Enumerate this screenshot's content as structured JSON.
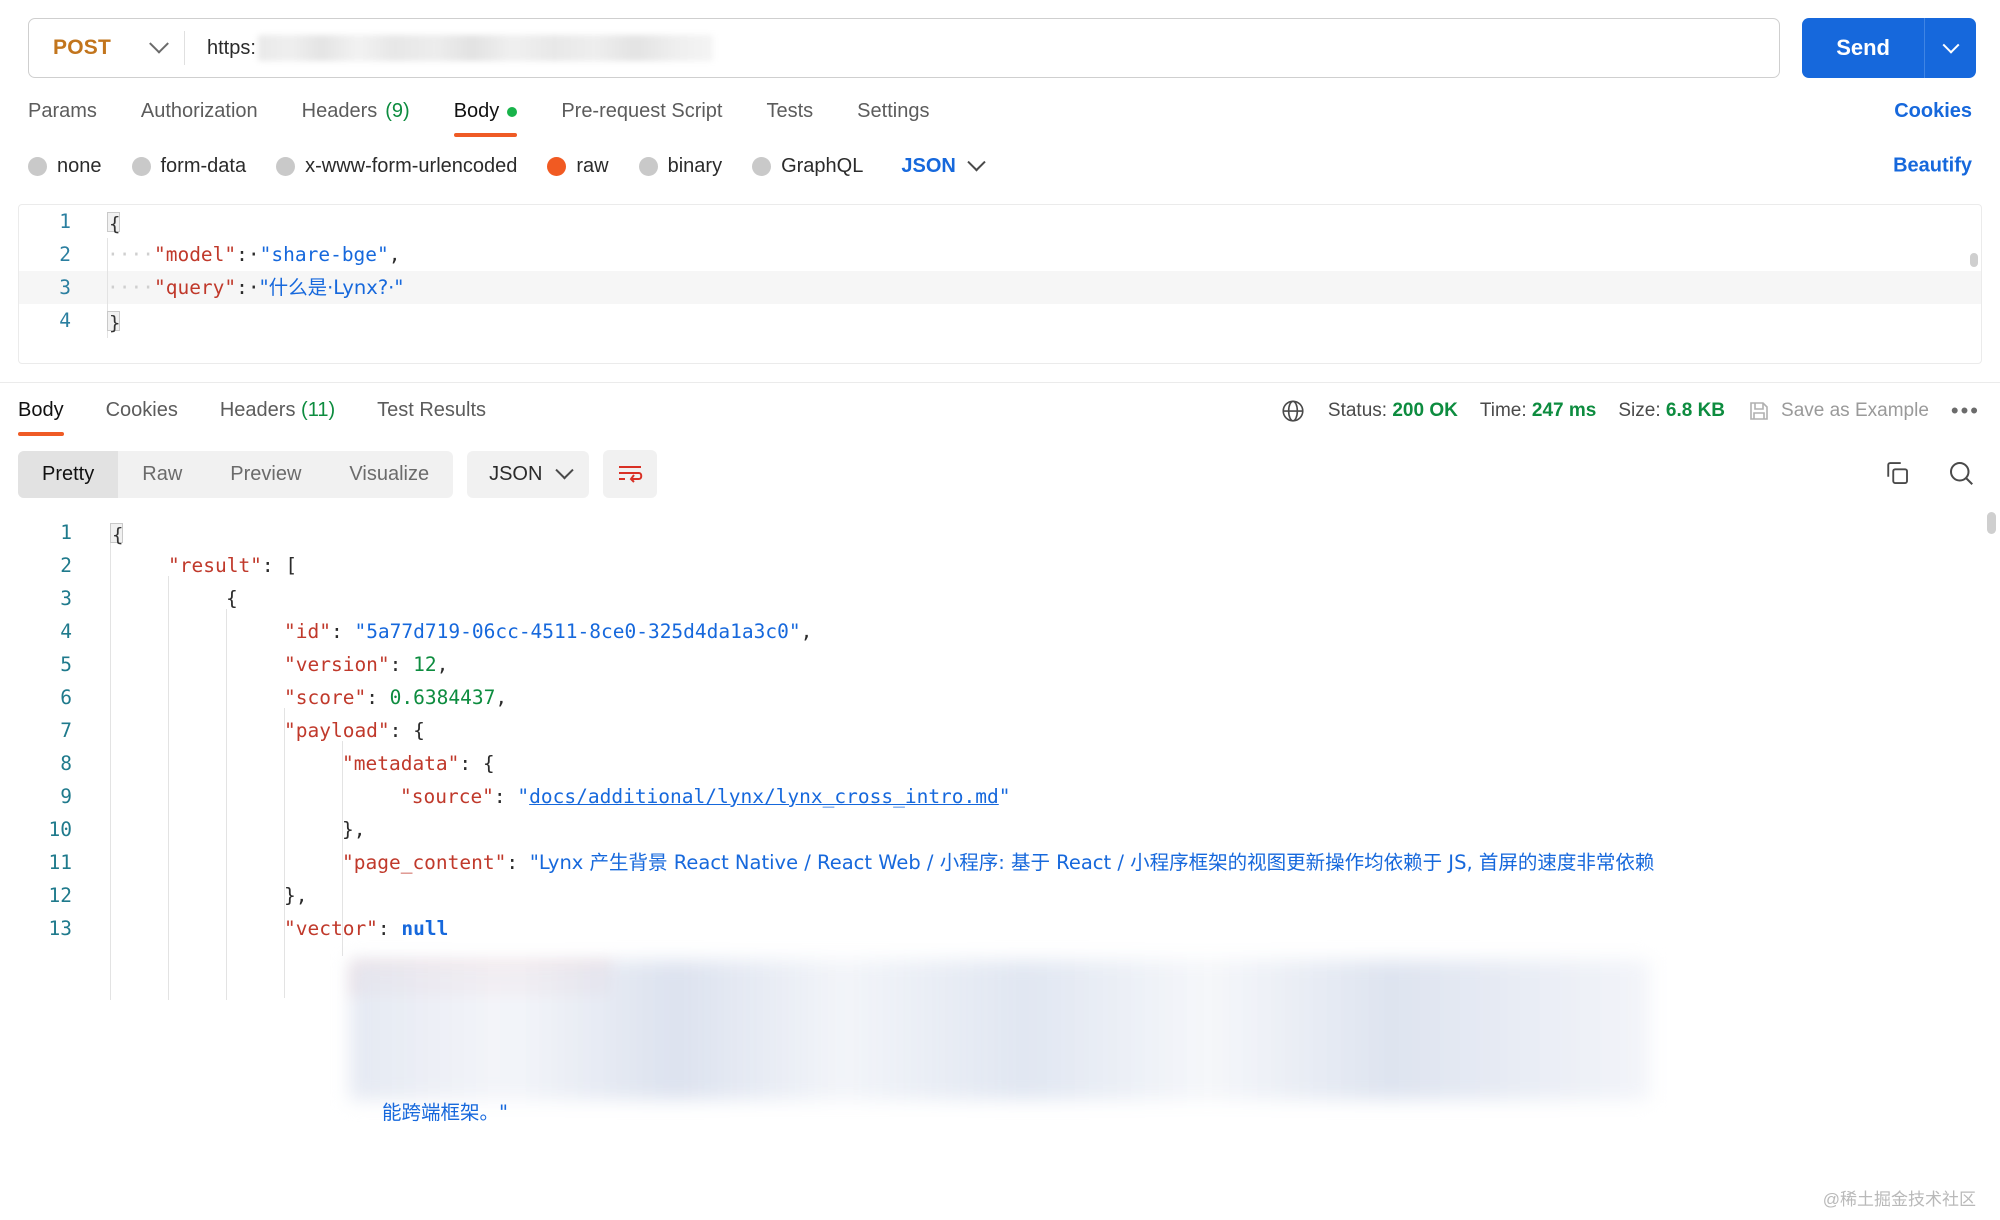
{
  "request": {
    "method": "POST",
    "url_scheme": "https:",
    "url_redacted": true,
    "send_label": "Send",
    "tabs": [
      {
        "label": "Params",
        "active": false,
        "count": null,
        "dot": false
      },
      {
        "label": "Authorization",
        "active": false,
        "count": null,
        "dot": false
      },
      {
        "label": "Headers",
        "active": false,
        "count": "(9)",
        "dot": false
      },
      {
        "label": "Body",
        "active": true,
        "count": null,
        "dot": true
      },
      {
        "label": "Pre-request Script",
        "active": false,
        "count": null,
        "dot": false
      },
      {
        "label": "Tests",
        "active": false,
        "count": null,
        "dot": false
      },
      {
        "label": "Settings",
        "active": false,
        "count": null,
        "dot": false
      }
    ],
    "cookies_link": "Cookies",
    "body_types": [
      {
        "label": "none",
        "selected": false
      },
      {
        "label": "form-data",
        "selected": false
      },
      {
        "label": "x-www-form-urlencoded",
        "selected": false
      },
      {
        "label": "raw",
        "selected": true
      },
      {
        "label": "binary",
        "selected": false
      },
      {
        "label": "GraphQL",
        "selected": false
      }
    ],
    "format_selected": "JSON",
    "beautify_label": "Beautify",
    "body_lines": [
      {
        "no": "1",
        "segments": [
          {
            "t": "fold-open",
            "v": "{"
          }
        ]
      },
      {
        "no": "2",
        "segments": [
          {
            "t": "dots",
            "v": "····"
          },
          {
            "t": "k",
            "v": "\"model\""
          },
          {
            "t": "p",
            "v": ":·"
          },
          {
            "t": "s",
            "v": "\"share-bge\""
          },
          {
            "t": "p",
            "v": ","
          }
        ]
      },
      {
        "no": "3",
        "highlight": true,
        "segments": [
          {
            "t": "dots",
            "v": "····"
          },
          {
            "t": "k",
            "v": "\"query\""
          },
          {
            "t": "p",
            "v": ":·"
          },
          {
            "t": "s",
            "v": "\"什么是·Lynx?·\""
          }
        ]
      },
      {
        "no": "4",
        "segments": [
          {
            "t": "fold-close",
            "v": "}"
          }
        ]
      }
    ]
  },
  "response": {
    "tabs": [
      {
        "label": "Body",
        "active": true,
        "count": null
      },
      {
        "label": "Cookies",
        "active": false,
        "count": null
      },
      {
        "label": "Headers",
        "active": false,
        "count": "(11)"
      },
      {
        "label": "Test Results",
        "active": false,
        "count": null
      }
    ],
    "status_label": "Status:",
    "status_value": "200 OK",
    "time_label": "Time:",
    "time_value": "247 ms",
    "size_label": "Size:",
    "size_value": "6.8 KB",
    "save_example_label": "Save as Example",
    "view_modes": [
      {
        "label": "Pretty",
        "active": true
      },
      {
        "label": "Raw",
        "active": false
      },
      {
        "label": "Preview",
        "active": false
      },
      {
        "label": "Visualize",
        "active": false
      }
    ],
    "format_selected": "JSON",
    "body_lines": [
      {
        "no": "1",
        "indent": 0,
        "segments": [
          {
            "t": "fold-open",
            "v": "{"
          }
        ]
      },
      {
        "no": "2",
        "indent": 1,
        "segments": [
          {
            "t": "k",
            "v": "\"result\""
          },
          {
            "t": "p",
            "v": ": ["
          }
        ]
      },
      {
        "no": "3",
        "indent": 2,
        "segments": [
          {
            "t": "p",
            "v": "{"
          }
        ]
      },
      {
        "no": "4",
        "indent": 3,
        "segments": [
          {
            "t": "k",
            "v": "\"id\""
          },
          {
            "t": "p",
            "v": ": "
          },
          {
            "t": "s",
            "v": "\"5a77d719-06cc-4511-8ce0-325d4da1a3c0\""
          },
          {
            "t": "p",
            "v": ","
          }
        ]
      },
      {
        "no": "5",
        "indent": 3,
        "segments": [
          {
            "t": "k",
            "v": "\"version\""
          },
          {
            "t": "p",
            "v": ": "
          },
          {
            "t": "n",
            "v": "12"
          },
          {
            "t": "p",
            "v": ","
          }
        ]
      },
      {
        "no": "6",
        "indent": 3,
        "segments": [
          {
            "t": "k",
            "v": "\"score\""
          },
          {
            "t": "p",
            "v": ": "
          },
          {
            "t": "n",
            "v": "0.6384437"
          },
          {
            "t": "p",
            "v": ","
          }
        ]
      },
      {
        "no": "7",
        "indent": 3,
        "segments": [
          {
            "t": "k",
            "v": "\"payload\""
          },
          {
            "t": "p",
            "v": ": {"
          }
        ]
      },
      {
        "no": "8",
        "indent": 4,
        "segments": [
          {
            "t": "k",
            "v": "\"metadata\""
          },
          {
            "t": "p",
            "v": ": {"
          }
        ]
      },
      {
        "no": "9",
        "indent": 5,
        "segments": [
          {
            "t": "k",
            "v": "\"source\""
          },
          {
            "t": "p",
            "v": ": "
          },
          {
            "t": "s",
            "v": "\""
          },
          {
            "t": "link",
            "v": "docs/additional/lynx/lynx_cross_intro.md"
          },
          {
            "t": "s",
            "v": "\""
          }
        ]
      },
      {
        "no": "10",
        "indent": 4,
        "segments": [
          {
            "t": "p",
            "v": "},"
          }
        ]
      },
      {
        "no": "11",
        "indent": 4,
        "segments": [
          {
            "t": "k",
            "v": "\"page_content\""
          },
          {
            "t": "p",
            "v": ": "
          },
          {
            "t": "s",
            "v": "\"Lynx 产生背景 React Native / React Web / 小程序: 基于 React / 小程序框架的视图更新操作均依赖于 JS, 首屏的速度非常依赖"
          }
        ]
      },
      {
        "no": "12",
        "indent": 3,
        "segments": [
          {
            "t": "p",
            "v": "},"
          }
        ]
      },
      {
        "no": "13",
        "indent": 3,
        "segments": [
          {
            "t": "k",
            "v": "\"vector\""
          },
          {
            "t": "p",
            "v": ": "
          },
          {
            "t": "null",
            "v": "null"
          }
        ]
      }
    ],
    "wrapped_tail_lines": [
      "能跨端框架。\""
    ]
  },
  "watermark": "@稀土掘金技术社区",
  "colors": {
    "accent_orange": "#ef5b25",
    "link_blue": "#1668dc",
    "method_orange": "#c2751d",
    "success_green": "#0d8c3f",
    "radio_selected": "#f15a22",
    "send_blue": "#1668dc"
  }
}
